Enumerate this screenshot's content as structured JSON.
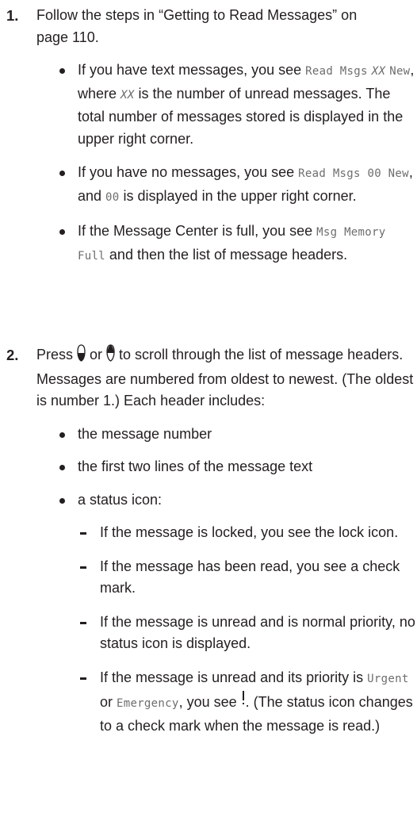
{
  "step1": {
    "number": "1.",
    "text": "Follow the steps in “Getting to Read Messages” on page 110.",
    "bullets": {
      "b1_a": "If you have text messages, you see ",
      "b1_lcd1": "Read Msgs",
      "b1_lcd_xx": "XX",
      "b1_lcd2": "New",
      "b1_b": ", where ",
      "b1_xx": "XX",
      "b1_c": " is the number of unread messages. The total number of messages stored is displayed in the upper right corner.",
      "b2_a": "If you have no messages, you see ",
      "b2_lcd": "Read Msgs 00 New",
      "b2_b": ", and ",
      "b2_lcd2": "00",
      "b2_c": " is displayed in the upper right corner.",
      "b3_a": "If the Message Center is full, you see ",
      "b3_lcd": "Msg Memory Full",
      "b3_b": " and then the list of message headers."
    }
  },
  "step2": {
    "number": "2.",
    "text_a": "Press ",
    "text_or": " or ",
    "text_b": " to scroll through the list of message headers. Messages are numbered from oldest to newest. (The oldest is number 1.) Each header includes:",
    "icons": {
      "down": "scroll-down-key-icon",
      "up": "scroll-up-key-icon",
      "urgent": "exclamation-icon"
    },
    "bullets": {
      "b1": "the message number",
      "b2": "the first two lines of the message text",
      "b3": "a status icon:"
    },
    "dashes": {
      "d1": "If the message is locked, you see the lock icon.",
      "d2": "If the message has been read, you see a check mark.",
      "d3": "If the message is unread and is normal priority, no status icon is displayed.",
      "d4_a": "If the message is unread and its priority is ",
      "d4_urgent": "Urgent",
      "d4_or": " or ",
      "d4_emergency": "Emergency",
      "d4_b": ", you see ",
      "d4_c": ". (The status icon changes to a check mark when the message is read.)"
    }
  }
}
